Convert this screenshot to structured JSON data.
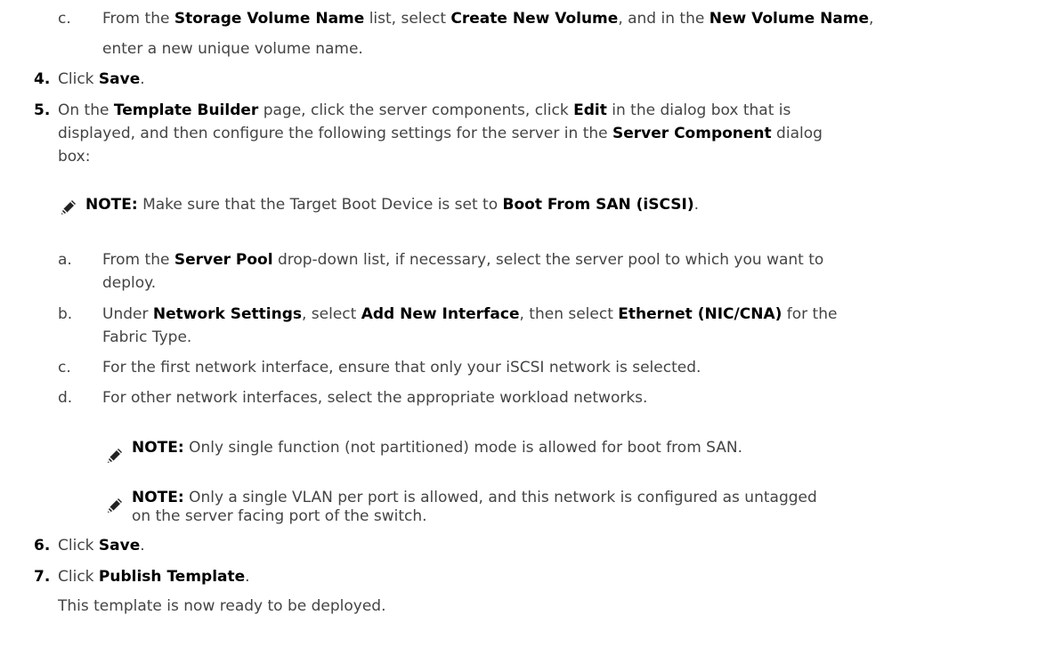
{
  "step3c": {
    "letter": "c.",
    "t1": "From the ",
    "b1": "Storage Volume Name",
    "t2": " list, select ",
    "b2": "Create New Volume",
    "t3": ", and in the ",
    "b3": "New Volume Name",
    "t4": ",",
    "line2": "enter a new unique volume name."
  },
  "step4": {
    "num": "4.",
    "t1": "Click ",
    "b1": "Save",
    "t2": "."
  },
  "step5": {
    "num": "5.",
    "l1_t1": "On the ",
    "l1_b1": "Template Builder",
    "l1_t2": " page, click the server components, click ",
    "l1_b2": "Edit",
    "l1_t3": " in the dialog box that is",
    "l2_t1": "displayed, and then configure the following settings for the server in the ",
    "l2_b1": "Server Component",
    "l2_t2": " dialog",
    "l3": "box:"
  },
  "note1": {
    "label": "NOTE:",
    "t1": " Make sure that the Target Boot Device is set to ",
    "b1": "Boot From SAN (iSCSI)",
    "t2": "."
  },
  "sub_a": {
    "letter": "a.",
    "t1": "From the ",
    "b1": "Server Pool",
    "t2": " drop-down list, if necessary, select the server pool to which you want to",
    "line2": "deploy."
  },
  "sub_b": {
    "letter": "b.",
    "t1": "Under ",
    "b1": "Network Settings",
    "t2": ", select ",
    "b2": "Add New Interface",
    "t3": ", then select ",
    "b3": "Ethernet (NIC/CNA)",
    "t4": " for the",
    "line2": "Fabric Type."
  },
  "sub_c": {
    "letter": "c.",
    "text": "For the first network interface, ensure that only your iSCSI network is selected."
  },
  "sub_d": {
    "letter": "d.",
    "text": "For other network interfaces, select the appropriate workload networks."
  },
  "note2": {
    "label": "NOTE:",
    "text": " Only single function (not partitioned) mode is allowed for boot from SAN."
  },
  "note3": {
    "label": "NOTE:",
    "text": " Only a single VLAN per port is allowed, and this network is configured as untagged",
    "line2": "on the server facing port of the switch."
  },
  "step6": {
    "num": "6.",
    "t1": "Click ",
    "b1": "Save",
    "t2": "."
  },
  "step7": {
    "num": "7.",
    "t1": "Click ",
    "b1": "Publish Template",
    "t2": ".",
    "line2": "This template is now ready to be deployed."
  },
  "icons": {
    "note": "pencil-note-icon"
  }
}
